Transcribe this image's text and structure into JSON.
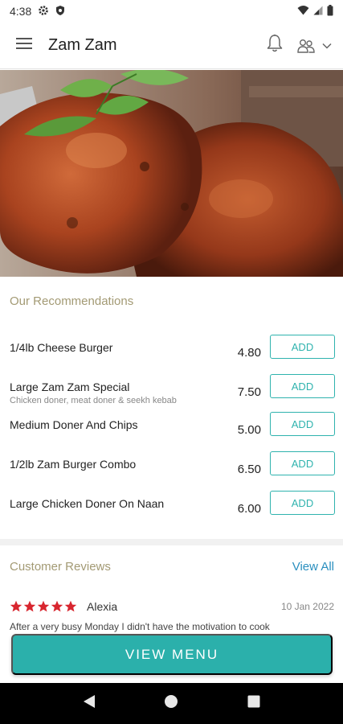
{
  "status_bar": {
    "time": "4:38"
  },
  "app_bar": {
    "title": "Zam Zam"
  },
  "recommendations": {
    "title": "Our Recommendations",
    "items": [
      {
        "name": "1/4lb Cheese Burger",
        "description": "",
        "price": "4.80",
        "button": "ADD"
      },
      {
        "name": "Large Zam Zam Special",
        "description": "Chicken doner, meat doner & seekh kebab",
        "price": "7.50",
        "button": "ADD"
      },
      {
        "name": "Medium Doner And Chips",
        "description": "",
        "price": "5.00",
        "button": "ADD"
      },
      {
        "name": "1/2lb Zam Burger Combo",
        "description": "",
        "price": "6.50",
        "button": "ADD"
      },
      {
        "name": "Large Chicken Doner On Naan",
        "description": "",
        "price": "6.00",
        "button": "ADD"
      }
    ]
  },
  "reviews": {
    "title": "Customer Reviews",
    "view_all": "View All",
    "items": [
      {
        "reviewer": "Alexia",
        "date": "10 Jan 2022",
        "rating": 5,
        "snippet": "After a very busy Monday I didn't have the motivation to cook"
      }
    ]
  },
  "view_menu": {
    "label": "VIEW MENU"
  },
  "colors": {
    "accent": "#2bb0ab",
    "section_title": "#a39a74",
    "link": "#2a8fbf",
    "star": "#d8262f"
  }
}
